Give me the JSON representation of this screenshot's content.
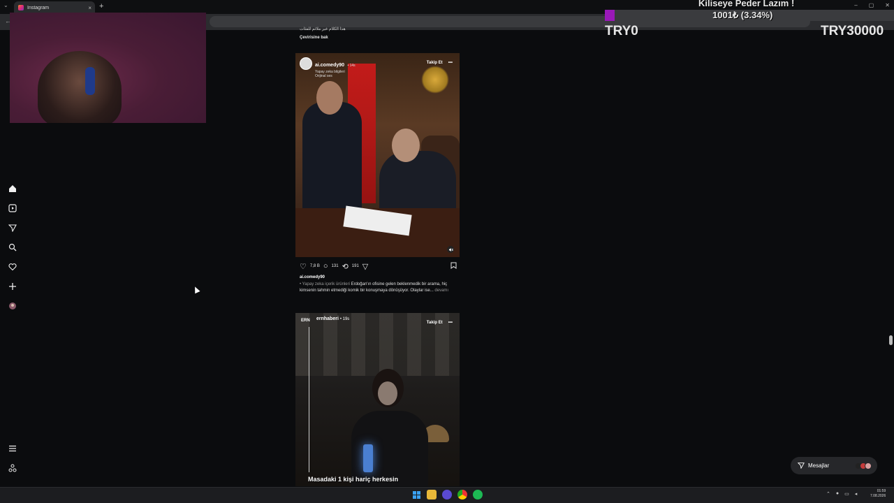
{
  "browser": {
    "tab_title": "Instagram",
    "new_tab": "+",
    "tab_close": "×",
    "dropdown": "⌄",
    "window_controls": [
      "–",
      "▢",
      "✕"
    ]
  },
  "stream_overlay": {
    "title": "Kiliseye Peder Lazım !",
    "goal_text": "1001₺ (3.34%)",
    "goal_min": "TRY0",
    "goal_max": "TRY30000",
    "goal_fraction": 0.0334,
    "fill_color": "#9a19b8"
  },
  "nav": {
    "icons": [
      "home-icon",
      "reels-icon",
      "send-icon",
      "search-icon",
      "heart-icon",
      "create-icon",
      "profile-icon",
      "menu-icon",
      "meta-icon"
    ]
  },
  "feed": {
    "top_caption": "هذا الكلام غير ملائم للفئات",
    "top_translate": "Çevirisine bak",
    "post1": {
      "username": "ai.comedy90",
      "time": "• 14s",
      "sub1": "Yapay zeka bilgileri",
      "sub2": "Orijinal ses",
      "follow": "Takip Et",
      "more": "•••",
      "likes": "7,8 B",
      "comments": "131",
      "reposts": "191",
      "caption_user": "ai.comedy90",
      "caption_tag": "• Yapay zeka içerik ürünleri",
      "caption_body": "Erdoğan'ın ofisine gelen beklenmedik bir arama, hiç kimsenin tahmin etmediği komik bir konuşmaya dönüşüyor. Olaylar ise...",
      "caption_more": "devamı"
    },
    "post2": {
      "source": "ERN",
      "username": "ernhaberi",
      "time": "• 19s",
      "follow": "Takip Et",
      "more": "•••",
      "overlay_text": "Masadaki 1 kişi hariç herkesin"
    }
  },
  "messages": {
    "label": "Mesajlar"
  },
  "taskbar": {
    "clock_time": "01:59",
    "clock_date": "7.08.2026"
  }
}
